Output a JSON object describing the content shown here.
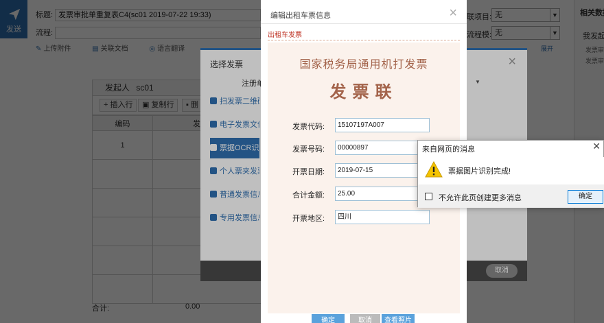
{
  "app": {
    "send_label": "发送",
    "title_label": "标题:",
    "title_value": "发票审批单重复表C4(sc01 2019-07-22 19:33)",
    "flow_label": "流程:",
    "flow_value": "",
    "toolbar": {
      "attach_label": "上传附件",
      "related_doc_label": "关联文档",
      "blur_item_label": "语言翻译"
    },
    "expand_label": "展开",
    "right_fields": [
      {
        "label": "联项目:",
        "value": "无"
      },
      {
        "label": "流程模:",
        "value": "无"
      }
    ],
    "side_panel": {
      "title": "相关数据",
      "subtitle": "我发起的",
      "items": [
        "发票审批",
        "发票审批"
      ]
    }
  },
  "grid": {
    "initiator_label": "发起人",
    "initiator_value": "sc01",
    "insert_row_label": "插入行",
    "copy_row_label": "复制行",
    "delete_row_label": "删",
    "col_index": "编码",
    "col_type": "发票类型",
    "rows": [
      "1",
      "",
      "",
      "",
      "",
      ""
    ],
    "sum_label": "合计:",
    "sum_value": "0.00"
  },
  "select_dialog": {
    "title": "选择发票",
    "label": "注册单",
    "menu": [
      {
        "label": "扫发票二维码",
        "active": false
      },
      {
        "label": "电子发票文件",
        "active": false
      },
      {
        "label": "票据OCR识别",
        "active": true
      },
      {
        "label": "个人票夹发票",
        "active": false
      },
      {
        "label": "普通发票信息",
        "active": false
      },
      {
        "label": "专用发票信息",
        "active": false
      }
    ],
    "cancel_label": "取消"
  },
  "invoice_dialog": {
    "title": "编辑出租车票信息",
    "tab_label": "出租车发票",
    "paper_title": "国家税务局通用机打发票",
    "paper_subtitle": "发票联",
    "fields": [
      {
        "label": "发票代码:",
        "value": "15107197A007"
      },
      {
        "label": "发票号码:",
        "value": "00000897"
      },
      {
        "label": "开票日期:",
        "value": "2019-07-15"
      },
      {
        "label": "合计金额:",
        "value": "25.00"
      },
      {
        "label": "开票地区:",
        "value": "四川"
      }
    ],
    "ok_label": "确定",
    "cancel_label": "取消",
    "preview_label": "查看照片"
  },
  "alert": {
    "title": "来自网页的消息",
    "message": "票据图片识别完成!",
    "checkbox_label": "不允许此页创建更多消息",
    "ok_label": "确定"
  },
  "colors": {
    "brand": "#2f6fb0",
    "paper": "#fbf2ec",
    "invoice_text": "#a3634a"
  }
}
